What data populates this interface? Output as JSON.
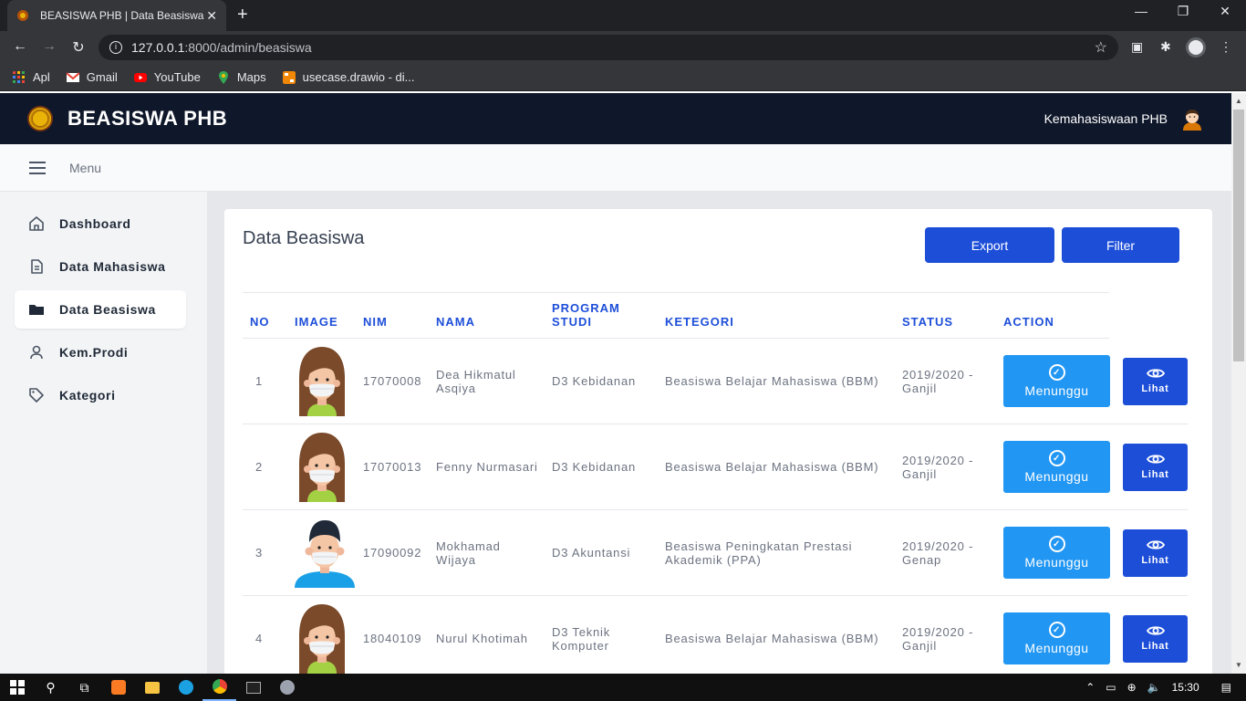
{
  "browser": {
    "tab_title": "BEASISWA PHB | Data Beasiswa",
    "url_host": "127.0.0.1",
    "url_path": ":8000/admin/beasiswa",
    "bookmarks": [
      "Apl",
      "Gmail",
      "YouTube",
      "Maps",
      "usecase.drawio - di..."
    ]
  },
  "header": {
    "brand": "BEASISWA PHB",
    "user": "Kemahasiswaan PHB"
  },
  "menubar": {
    "label": "Menu"
  },
  "sidebar": {
    "items": [
      {
        "label": "Dashboard",
        "icon": "home-icon"
      },
      {
        "label": "Data Mahasiswa",
        "icon": "document-icon"
      },
      {
        "label": "Data Beasiswa",
        "icon": "folder-icon",
        "active": true
      },
      {
        "label": "Kem.Prodi",
        "icon": "user-icon"
      },
      {
        "label": "Kategori",
        "icon": "tag-icon"
      }
    ]
  },
  "main": {
    "title": "Data Beasiswa",
    "export_label": "Export",
    "filter_label": "Filter",
    "columns": [
      "NO",
      "IMAGE",
      "NIM",
      "NAMA",
      "PROGRAM STUDI",
      "KETEGORI",
      "STATUS",
      "ACTION"
    ],
    "rows": [
      {
        "no": "1",
        "nim": "17070008",
        "nama": "Dea Hikmatul Asqiya",
        "prodi": "D3 Kebidanan",
        "kategori": "Beasiswa Belajar Mahasiswa (BBM)",
        "status": "2019/2020 - Ganjil",
        "action": "Menunggu",
        "view": "Lihat",
        "avatar": "female"
      },
      {
        "no": "2",
        "nim": "17070013",
        "nama": "Fenny Nurmasari",
        "prodi": "D3 Kebidanan",
        "kategori": "Beasiswa Belajar Mahasiswa (BBM)",
        "status": "2019/2020 - Ganjil",
        "action": "Menunggu",
        "view": "Lihat",
        "avatar": "female"
      },
      {
        "no": "3",
        "nim": "17090092",
        "nama": "Mokhamad Wijaya",
        "prodi": "D3 Akuntansi",
        "kategori": "Beasiswa Peningkatan Prestasi Akademik (PPA)",
        "status": "2019/2020 - Genap",
        "action": "Menunggu",
        "view": "Lihat",
        "avatar": "male"
      },
      {
        "no": "4",
        "nim": "18040109",
        "nama": "Nurul Khotimah",
        "prodi": "D3 Teknik Komputer",
        "kategori": "Beasiswa Belajar Mahasiswa (BBM)",
        "status": "2019/2020 - Ganjil",
        "action": "Menunggu",
        "view": "Lihat",
        "avatar": "female"
      }
    ]
  },
  "taskbar": {
    "time": "15:30"
  },
  "colors": {
    "primary": "#1d4ed8",
    "waiting": "#2196f3",
    "header_bg": "#0f172a"
  }
}
